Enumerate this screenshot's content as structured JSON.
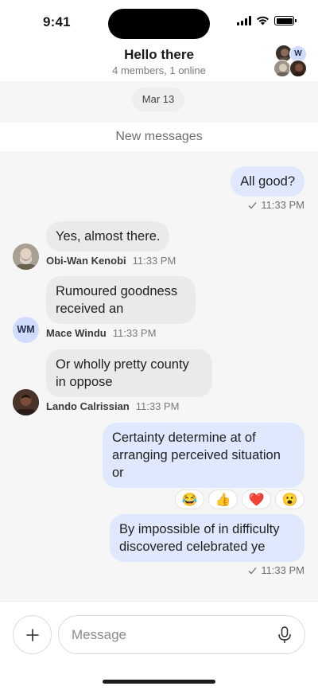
{
  "status": {
    "time": "9:41"
  },
  "chat": {
    "title": "Hello there",
    "subtitle": "4 members, 1 online",
    "group_avatar_initial": "W"
  },
  "date_separator": "Mar 13",
  "new_messages_label": "New messages",
  "messages": [
    {
      "direction": "out",
      "text": "All good?",
      "time": "11:33 PM",
      "status_icon": "check-icon"
    },
    {
      "direction": "in",
      "text": "Yes, almost there.",
      "sender": "Obi-Wan Kenobi",
      "time": "11:33 PM",
      "avatar": "photo"
    },
    {
      "direction": "in",
      "text": "Rumoured goodness received an",
      "sender": "Mace Windu",
      "time": "11:33 PM",
      "avatar_initials": "WM"
    },
    {
      "direction": "in",
      "text": "Or wholly pretty county in oppose",
      "sender": "Lando Calrissian",
      "time": "11:33 PM",
      "avatar": "photo"
    },
    {
      "direction": "out",
      "text": "Certainty determine at of arranging perceived situation or",
      "reactions": [
        "😂",
        "👍",
        "❤️",
        "😮"
      ]
    },
    {
      "direction": "out",
      "text": "By impossible of in difficulty discovered celebrated ye",
      "time": "11:33 PM",
      "status_icon": "check-icon"
    }
  ],
  "composer": {
    "placeholder": "Message",
    "value": ""
  },
  "colors": {
    "outgoing_bubble": "#dfe8fd",
    "incoming_bubble": "#e9eaec",
    "initials_avatar": "#cfdcfb"
  }
}
